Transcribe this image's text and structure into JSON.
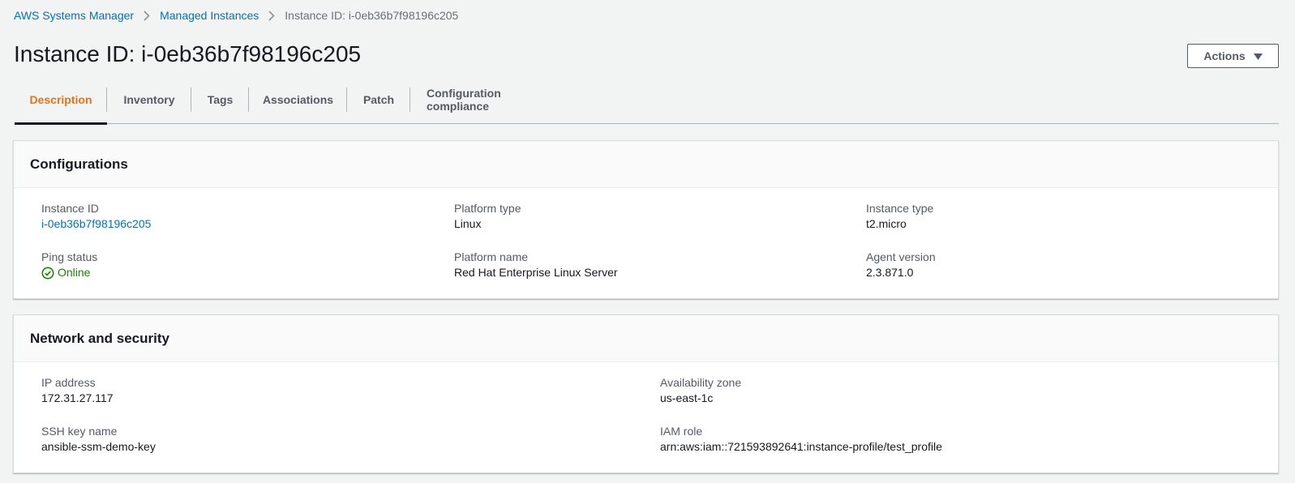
{
  "breadcrumb": {
    "items": [
      "AWS Systems Manager",
      "Managed Instances"
    ],
    "current": "Instance ID: i-0eb36b7f98196c205"
  },
  "page": {
    "title": "Instance ID: i-0eb36b7f98196c205",
    "actions_label": "Actions"
  },
  "tabs": [
    {
      "label": "Description",
      "active": true
    },
    {
      "label": "Inventory"
    },
    {
      "label": "Tags"
    },
    {
      "label": "Associations"
    },
    {
      "label": "Patch"
    },
    {
      "label": "Configuration compliance"
    }
  ],
  "configurations": {
    "title": "Configurations",
    "instance_id_label": "Instance ID",
    "instance_id": "i-0eb36b7f98196c205",
    "ping_status_label": "Ping status",
    "ping_status": "Online",
    "platform_type_label": "Platform type",
    "platform_type": "Linux",
    "platform_name_label": "Platform name",
    "platform_name": "Red Hat Enterprise Linux Server",
    "instance_type_label": "Instance type",
    "instance_type": "t2.micro",
    "agent_version_label": "Agent version",
    "agent_version": "2.3.871.0"
  },
  "network": {
    "title": "Network and security",
    "ip_address_label": "IP address",
    "ip_address": "172.31.27.117",
    "ssh_key_label": "SSH key name",
    "ssh_key": "ansible-ssm-demo-key",
    "availability_zone_label": "Availability zone",
    "availability_zone": "us-east-1c",
    "iam_role_label": "IAM role",
    "iam_role": "arn:aws:iam::721593892641:instance-profile/test_profile"
  },
  "colors": {
    "link": "#0073bb",
    "active_tab": "#ec7211",
    "online": "#1d8102",
    "background": "#f2f3f3"
  },
  "icons": {
    "breadcrumb_separator": "chevron-right-icon",
    "actions_caret": "caret-down-icon",
    "status": "check-circle-icon"
  }
}
